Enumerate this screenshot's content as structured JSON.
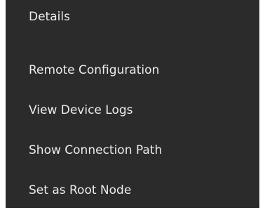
{
  "context_menu": {
    "items": [
      {
        "label": "Details"
      },
      {
        "label": "Remote Configuration"
      },
      {
        "label": "View Device Logs"
      },
      {
        "label": "Show Connection Path"
      },
      {
        "label": "Set as Root Node"
      }
    ]
  },
  "colors": {
    "menu_background": "#2b2b2b",
    "menu_text": "#ececec"
  }
}
